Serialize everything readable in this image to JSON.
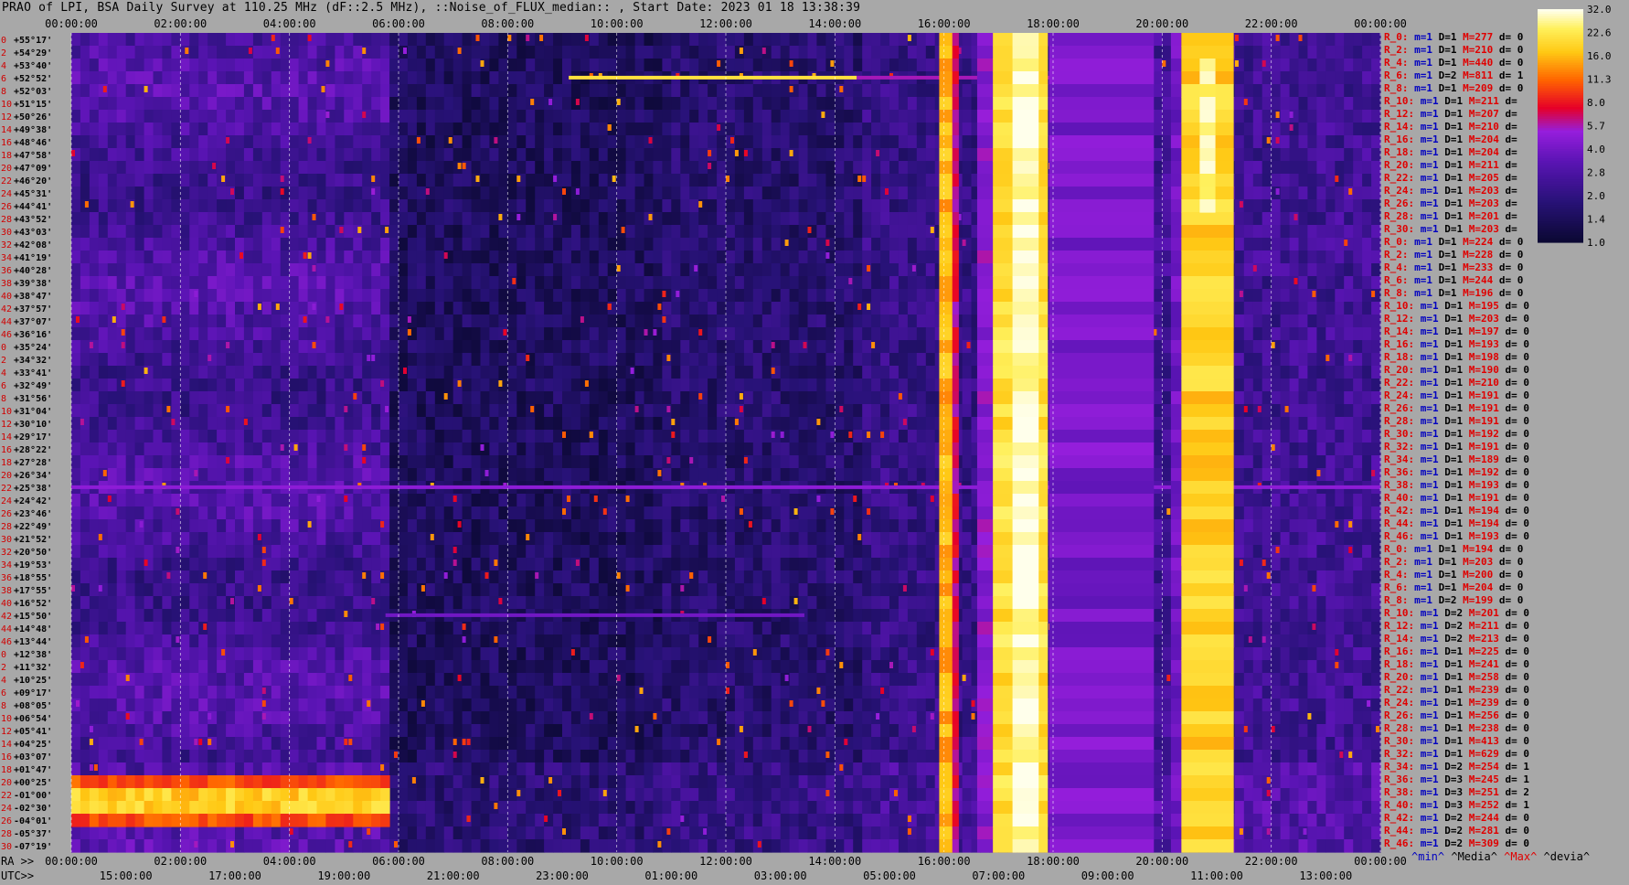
{
  "title": "PRAO of LPI, BSA Daily Survey at 110.25 MHz (dF::2.5 MHz), ::Noise_of_FLUX_median:: , Start Date: 2023 01 18 13:38:39",
  "colors": {
    "background": "#a8a8a8",
    "plot_dark": "#0a0830",
    "low_purple": "#3a1a90",
    "mid_purple": "#8a1ad8",
    "red": "#e80010",
    "orange": "#ff8a00",
    "yellow": "#ffe840",
    "white": "#ffffe8"
  },
  "footer": {
    "ra_prefix": "RA >>",
    "utc_prefix": "UTC>>",
    "ra_ticks": [
      "00:00:00",
      "02:00:00",
      "04:00:00",
      "06:00:00",
      "08:00:00",
      "10:00:00",
      "12:00:00",
      "14:00:00",
      "16:00:00",
      "18:00:00",
      "20:00:00",
      "22:00:00",
      "00:00:00"
    ],
    "utc_ticks": [
      "15:00:00",
      "17:00:00",
      "19:00:00",
      "21:00:00",
      "23:00:00",
      "01:00:00",
      "03:00:00",
      "05:00:00",
      "07:00:00",
      "09:00:00",
      "11:00:00",
      "13:00:00"
    ],
    "key": {
      "min": "^min^",
      "median": "^Media^",
      "max": "^Max^",
      "devia": "^devia^"
    }
  },
  "chart_data": {
    "type": "heatmap",
    "title": "PRAO of LPI, BSA Daily Survey at 110.25 MHz (dF::2.5 MHz), ::Noise_of_FLUX_median:: , Start Date: 2023 01 18 13:38:39",
    "x_axis": {
      "top_ticks": [
        "00:00:00",
        "02:00:00",
        "04:00:00",
        "06:00:00",
        "08:00:00",
        "10:00:00",
        "12:00:00",
        "14:00:00",
        "16:00:00",
        "18:00:00",
        "20:00:00",
        "22:00:00",
        "00:00:00"
      ]
    },
    "y_axis": {
      "ticks": [
        "+55°17'",
        "+54°29'",
        "+53°40'",
        "+52°52'",
        "+52°03'",
        "+51°15'",
        "+50°26'",
        "+49°38'",
        "+48°46'",
        "+47°58'",
        "+47°09'",
        "+46°20'",
        "+45°31'",
        "+44°41'",
        "+43°52'",
        "+43°03'",
        "+42°08'",
        "+41°19'",
        "+40°28'",
        "+39°38'",
        "+38°47'",
        "+37°57'",
        "+37°07'",
        "+36°16'",
        "+35°24'",
        "+34°32'",
        "+33°41'",
        "+32°49'",
        "+31°56'",
        "+31°04'",
        "+30°10'",
        "+29°17'",
        "+28°22'",
        "+27°28'",
        "+26°34'",
        "+25°38'",
        "+24°42'",
        "+23°46'",
        "+22°49'",
        "+21°52'",
        "+20°50'",
        "+19°53'",
        "+18°55'",
        "+17°55'",
        "+16°52'",
        "+15°50'",
        "+14°48'",
        "+13°44'",
        "+12°38'",
        "+11°32'",
        "+10°25'",
        "+09°17'",
        "+08°05'",
        "+06°54'",
        "+05°41'",
        "+04°25'",
        "+03°07'",
        "+01°47'",
        "+00°25'",
        "-01°00'",
        "-02°30'",
        "-04°01'",
        "-05°37'",
        "-07°19'"
      ],
      "row_index": [
        "0",
        "2",
        "4",
        "6",
        "8",
        "10",
        "12",
        "14",
        "16",
        "18",
        "20",
        "22",
        "24",
        "26",
        "28",
        "30",
        "32",
        "34",
        "36",
        "38",
        "40",
        "42",
        "44",
        "46",
        "0",
        "2",
        "4",
        "6",
        "8",
        "10",
        "12",
        "14",
        "16",
        "18",
        "20",
        "22",
        "24",
        "26",
        "28",
        "30",
        "32",
        "34",
        "36",
        "38",
        "40",
        "42",
        "44",
        "46",
        "0",
        "2",
        "4",
        "6",
        "8",
        "10",
        "12",
        "14",
        "16",
        "18",
        "20",
        "22",
        "24",
        "26",
        "28",
        "30"
      ]
    },
    "colorbar": {
      "ticks": [
        "32.0",
        "22.6",
        "16.0",
        "11.3",
        "8.0",
        "5.7",
        "4.0",
        "2.8",
        "2.0",
        "1.4",
        "1.0"
      ],
      "scale": "log"
    },
    "row_stats": [
      {
        "label": "R_0:",
        "min": "m=1",
        "dev": "D=1",
        "max": "M=277",
        "d": "d= 0"
      },
      {
        "label": "R_2:",
        "min": "m=1",
        "dev": "D=1",
        "max": "M=210",
        "d": "d= 0"
      },
      {
        "label": "R_4:",
        "min": "m=1",
        "dev": "D=1",
        "max": "M=440",
        "d": "d= 0"
      },
      {
        "label": "R_6:",
        "min": "m=1",
        "dev": "D=2",
        "max": "M=811",
        "d": "d= 1"
      },
      {
        "label": "R_8:",
        "min": "m=1",
        "dev": "D=1",
        "max": "M=209",
        "d": "d= 0"
      },
      {
        "label": "R_10:",
        "min": "m=1",
        "dev": "D=1",
        "max": "M=211",
        "d": "d="
      },
      {
        "label": "R_12:",
        "min": "m=1",
        "dev": "D=1",
        "max": "M=207",
        "d": "d="
      },
      {
        "label": "R_14:",
        "min": "m=1",
        "dev": "D=1",
        "max": "M=210",
        "d": "d="
      },
      {
        "label": "R_16:",
        "min": "m=1",
        "dev": "D=1",
        "max": "M=204",
        "d": "d="
      },
      {
        "label": "R_18:",
        "min": "m=1",
        "dev": "D=1",
        "max": "M=204",
        "d": "d="
      },
      {
        "label": "R_20:",
        "min": "m=1",
        "dev": "D=1",
        "max": "M=211",
        "d": "d="
      },
      {
        "label": "R_22:",
        "min": "m=1",
        "dev": "D=1",
        "max": "M=205",
        "d": "d="
      },
      {
        "label": "R_24:",
        "min": "m=1",
        "dev": "D=1",
        "max": "M=203",
        "d": "d="
      },
      {
        "label": "R_26:",
        "min": "m=1",
        "dev": "D=1",
        "max": "M=203",
        "d": "d="
      },
      {
        "label": "R_28:",
        "min": "m=1",
        "dev": "D=1",
        "max": "M=201",
        "d": "d="
      },
      {
        "label": "R_30:",
        "min": "m=1",
        "dev": "D=1",
        "max": "M=203",
        "d": "d="
      },
      {
        "label": "R_0:",
        "min": "m=1",
        "dev": "D=1",
        "max": "M=224",
        "d": "d= 0"
      },
      {
        "label": "R_2:",
        "min": "m=1",
        "dev": "D=1",
        "max": "M=228",
        "d": "d= 0"
      },
      {
        "label": "R_4:",
        "min": "m=1",
        "dev": "D=1",
        "max": "M=233",
        "d": "d= 0"
      },
      {
        "label": "R_6:",
        "min": "m=1",
        "dev": "D=1",
        "max": "M=244",
        "d": "d= 0"
      },
      {
        "label": "R_8:",
        "min": "m=1",
        "dev": "D=1",
        "max": "M=196",
        "d": "d= 0"
      },
      {
        "label": "R_10:",
        "min": "m=1",
        "dev": "D=1",
        "max": "M=195",
        "d": "d= 0"
      },
      {
        "label": "R_12:",
        "min": "m=1",
        "dev": "D=1",
        "max": "M=203",
        "d": "d= 0"
      },
      {
        "label": "R_14:",
        "min": "m=1",
        "dev": "D=1",
        "max": "M=197",
        "d": "d= 0"
      },
      {
        "label": "R_16:",
        "min": "m=1",
        "dev": "D=1",
        "max": "M=193",
        "d": "d= 0"
      },
      {
        "label": "R_18:",
        "min": "m=1",
        "dev": "D=1",
        "max": "M=198",
        "d": "d= 0"
      },
      {
        "label": "R_20:",
        "min": "m=1",
        "dev": "D=1",
        "max": "M=190",
        "d": "d= 0"
      },
      {
        "label": "R_22:",
        "min": "m=1",
        "dev": "D=1",
        "max": "M=210",
        "d": "d= 0"
      },
      {
        "label": "R_24:",
        "min": "m=1",
        "dev": "D=1",
        "max": "M=191",
        "d": "d= 0"
      },
      {
        "label": "R_26:",
        "min": "m=1",
        "dev": "D=1",
        "max": "M=191",
        "d": "d= 0"
      },
      {
        "label": "R_28:",
        "min": "m=1",
        "dev": "D=1",
        "max": "M=191",
        "d": "d= 0"
      },
      {
        "label": "R_30:",
        "min": "m=1",
        "dev": "D=1",
        "max": "M=192",
        "d": "d= 0"
      },
      {
        "label": "R_32:",
        "min": "m=1",
        "dev": "D=1",
        "max": "M=191",
        "d": "d= 0"
      },
      {
        "label": "R_34:",
        "min": "m=1",
        "dev": "D=1",
        "max": "M=189",
        "d": "d= 0"
      },
      {
        "label": "R_36:",
        "min": "m=1",
        "dev": "D=1",
        "max": "M=192",
        "d": "d= 0"
      },
      {
        "label": "R_38:",
        "min": "m=1",
        "dev": "D=1",
        "max": "M=193",
        "d": "d= 0"
      },
      {
        "label": "R_40:",
        "min": "m=1",
        "dev": "D=1",
        "max": "M=191",
        "d": "d= 0"
      },
      {
        "label": "R_42:",
        "min": "m=1",
        "dev": "D=1",
        "max": "M=194",
        "d": "d= 0"
      },
      {
        "label": "R_44:",
        "min": "m=1",
        "dev": "D=1",
        "max": "M=194",
        "d": "d= 0"
      },
      {
        "label": "R_46:",
        "min": "m=1",
        "dev": "D=1",
        "max": "M=193",
        "d": "d= 0"
      },
      {
        "label": "R_0:",
        "min": "m=1",
        "dev": "D=1",
        "max": "M=194",
        "d": "d= 0"
      },
      {
        "label": "R_2:",
        "min": "m=1",
        "dev": "D=1",
        "max": "M=203",
        "d": "d= 0"
      },
      {
        "label": "R_4:",
        "min": "m=1",
        "dev": "D=1",
        "max": "M=200",
        "d": "d= 0"
      },
      {
        "label": "R_6:",
        "min": "m=1",
        "dev": "D=1",
        "max": "M=204",
        "d": "d= 0"
      },
      {
        "label": "R_8:",
        "min": "m=1",
        "dev": "D=2",
        "max": "M=199",
        "d": "d= 0"
      },
      {
        "label": "R_10:",
        "min": "m=1",
        "dev": "D=2",
        "max": "M=201",
        "d": "d= 0"
      },
      {
        "label": "R_12:",
        "min": "m=1",
        "dev": "D=2",
        "max": "M=211",
        "d": "d= 0"
      },
      {
        "label": "R_14:",
        "min": "m=1",
        "dev": "D=2",
        "max": "M=213",
        "d": "d= 0"
      },
      {
        "label": "R_16:",
        "min": "m=1",
        "dev": "D=1",
        "max": "M=225",
        "d": "d= 0"
      },
      {
        "label": "R_18:",
        "min": "m=1",
        "dev": "D=1",
        "max": "M=241",
        "d": "d= 0"
      },
      {
        "label": "R_20:",
        "min": "m=1",
        "dev": "D=1",
        "max": "M=258",
        "d": "d= 0"
      },
      {
        "label": "R_22:",
        "min": "m=1",
        "dev": "D=1",
        "max": "M=239",
        "d": "d= 0"
      },
      {
        "label": "R_24:",
        "min": "m=1",
        "dev": "D=1",
        "max": "M=239",
        "d": "d= 0"
      },
      {
        "label": "R_26:",
        "min": "m=1",
        "dev": "D=1",
        "max": "M=256",
        "d": "d= 0"
      },
      {
        "label": "R_28:",
        "min": "m=1",
        "dev": "D=1",
        "max": "M=238",
        "d": "d= 0"
      },
      {
        "label": "R_30:",
        "min": "m=1",
        "dev": "D=1",
        "max": "M=413",
        "d": "d= 0"
      },
      {
        "label": "R_32:",
        "min": "m=1",
        "dev": "D=1",
        "max": "M=629",
        "d": "d= 0"
      },
      {
        "label": "R_34:",
        "min": "m=1",
        "dev": "D=2",
        "max": "M=254",
        "d": "d= 1"
      },
      {
        "label": "R_36:",
        "min": "m=1",
        "dev": "D=3",
        "max": "M=245",
        "d": "d= 1"
      },
      {
        "label": "R_38:",
        "min": "m=1",
        "dev": "D=3",
        "max": "M=251",
        "d": "d= 2"
      },
      {
        "label": "R_40:",
        "min": "m=1",
        "dev": "D=3",
        "max": "M=252",
        "d": "d= 1"
      },
      {
        "label": "R_42:",
        "min": "m=1",
        "dev": "D=2",
        "max": "M=244",
        "d": "d= 0"
      },
      {
        "label": "R_44:",
        "min": "m=1",
        "dev": "D=2",
        "max": "M=281",
        "d": "d= 0"
      },
      {
        "label": "R_46:",
        "min": "m=1",
        "dev": "D=2",
        "max": "M=309",
        "d": "d= 0"
      }
    ]
  }
}
